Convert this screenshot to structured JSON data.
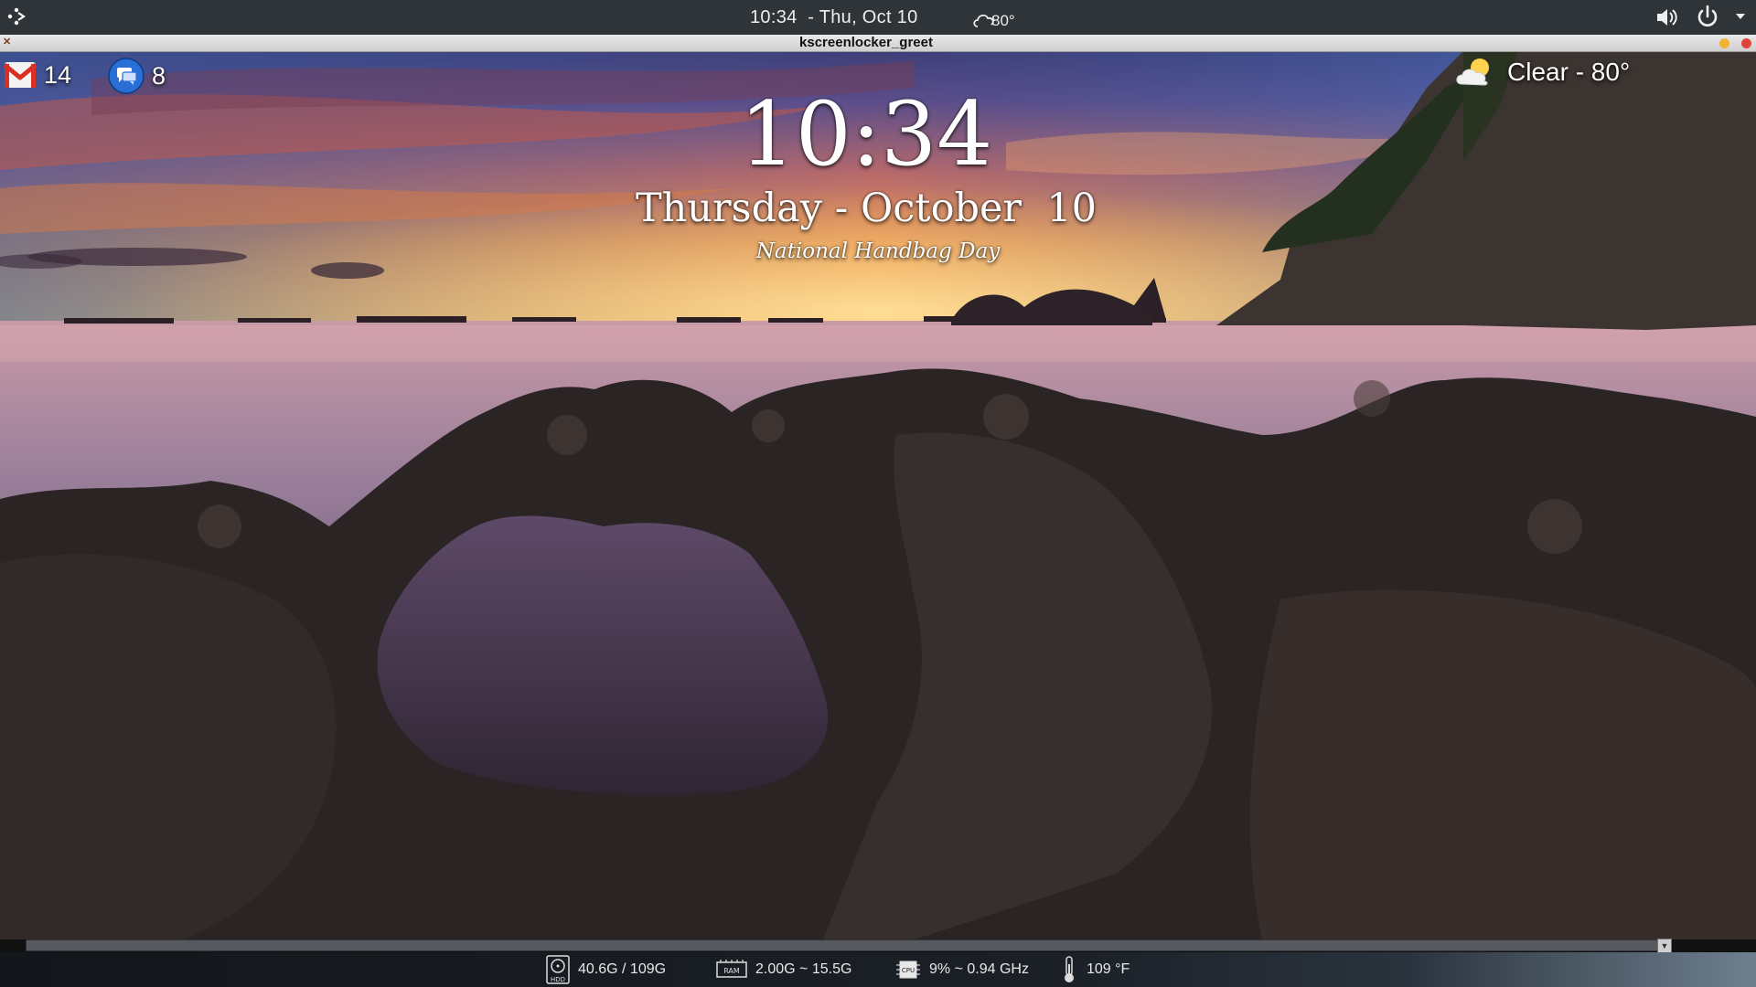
{
  "top_panel": {
    "clock": "10:34  - Thu, Oct 10",
    "weather_temp": "80°",
    "icons": {
      "launcher": "launcher-icon",
      "weather": "cloud-icon",
      "volume": "volume-icon",
      "power": "power-icon",
      "menu": "chevron-down-icon"
    }
  },
  "window": {
    "title": "kscreenlocker_greet"
  },
  "notifications": {
    "gmail_count": "14",
    "chat_count": "8"
  },
  "lockscreen": {
    "time": "10:34",
    "date": "Thursday - October  10",
    "holiday": "National Handbag Day",
    "weather": "Clear - 80°"
  },
  "status_bar": {
    "hdd_label": "HDD",
    "hdd": "40.6G / 109G",
    "ram_label": "RAM",
    "ram": "2.00G ~ 15.5G",
    "cpu_label": "CPU",
    "cpu": "9% ~ 0.94 GHz",
    "temp": "109 °F"
  },
  "colors": {
    "panel": "#2f3438",
    "gmail_red": "#d93025",
    "chat_blue": "#2a6fd6",
    "close_button": "#e0443a",
    "minimize_button": "#f2b233"
  }
}
